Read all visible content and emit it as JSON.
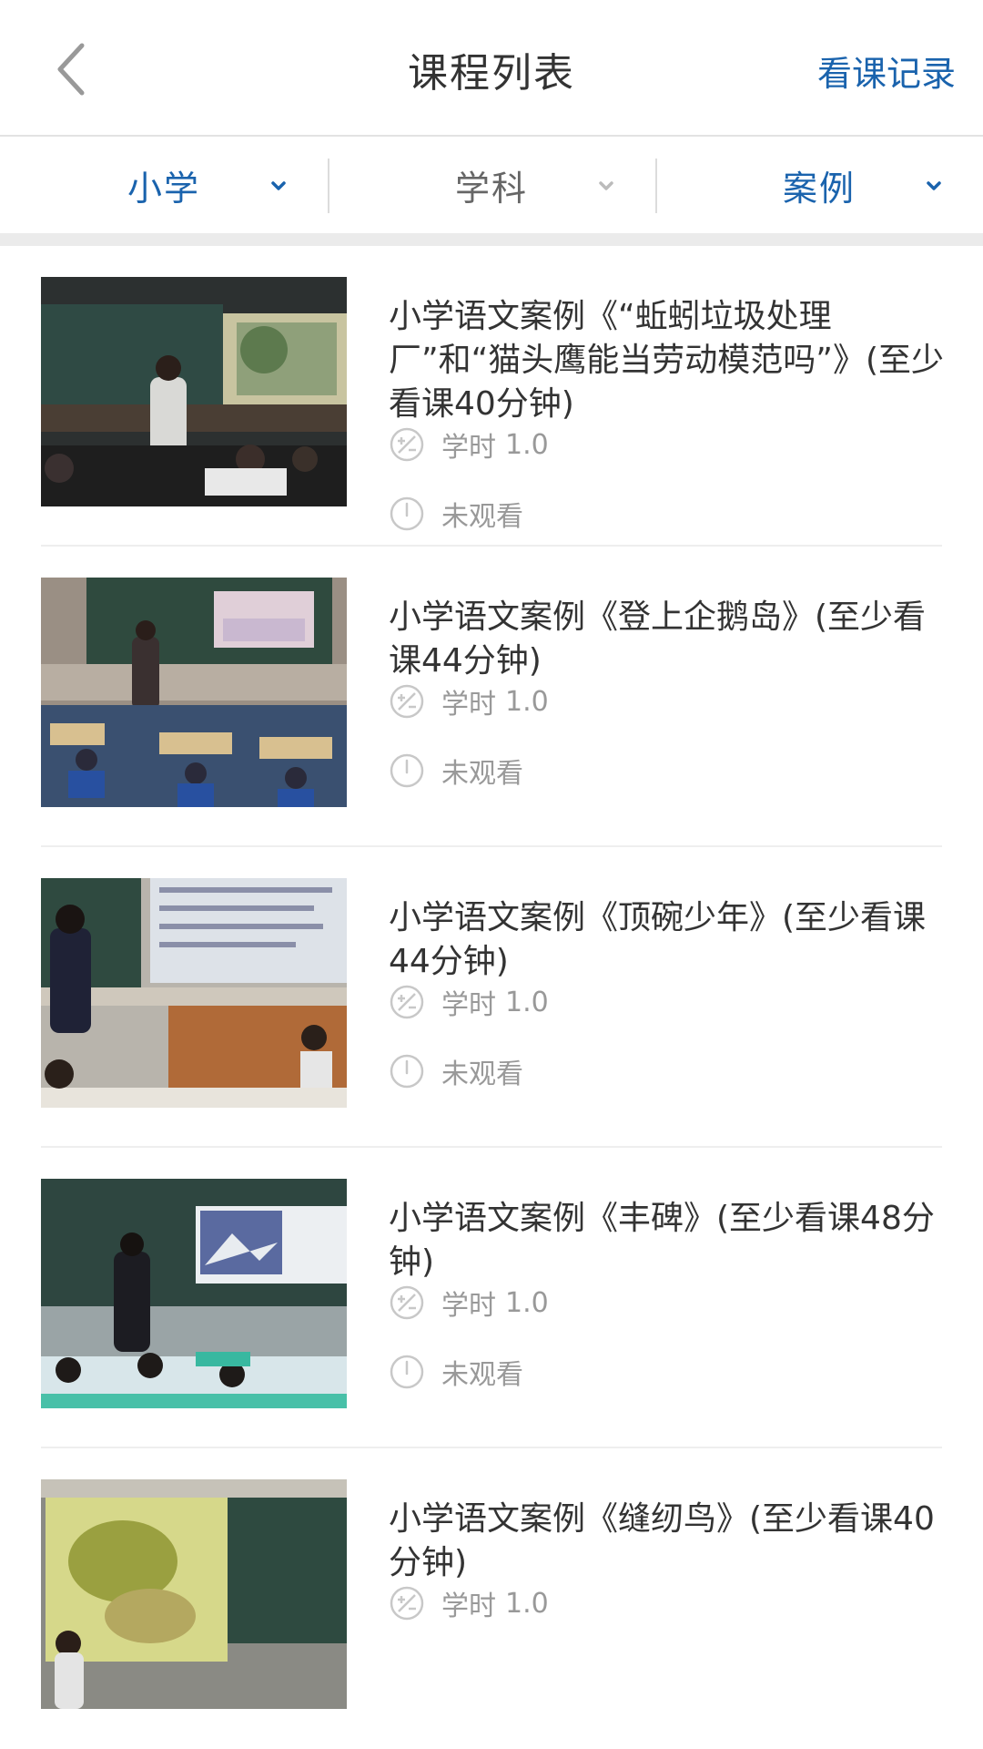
{
  "header": {
    "title": "课程列表",
    "history_link": "看课记录"
  },
  "filters": [
    {
      "label": "小学",
      "active": true
    },
    {
      "label": "学科",
      "active": false
    },
    {
      "label": "案例",
      "active": true
    }
  ],
  "colors": {
    "accent": "#1a63ad",
    "text": "#333333",
    "muted": "#999999"
  },
  "courses": [
    {
      "title": "小学语文案例《“蚯蚓垃圾处理厂”和“猫头鹰能当劳动模范吗”》(至少看课40分钟)",
      "credit_label": "学时",
      "credit_value": "1.0",
      "status": "未观看"
    },
    {
      "title": "小学语文案例《登上企鹅岛》(至少看课44分钟)",
      "credit_label": "学时",
      "credit_value": "1.0",
      "status": "未观看"
    },
    {
      "title": "小学语文案例《顶碗少年》(至少看课44分钟)",
      "credit_label": "学时",
      "credit_value": "1.0",
      "status": "未观看"
    },
    {
      "title": "小学语文案例《丰碑》(至少看课48分钟)",
      "credit_label": "学时",
      "credit_value": "1.0",
      "status": "未观看"
    },
    {
      "title": "小学语文案例《缝纫鸟》(至少看课40分钟)",
      "credit_label": "学时",
      "credit_value": "1.0",
      "status": ""
    }
  ],
  "icons": {
    "back": "chevron-left-icon",
    "dropdown": "chevron-down-icon",
    "credit": "credit-hours-icon",
    "status": "clock-icon"
  }
}
